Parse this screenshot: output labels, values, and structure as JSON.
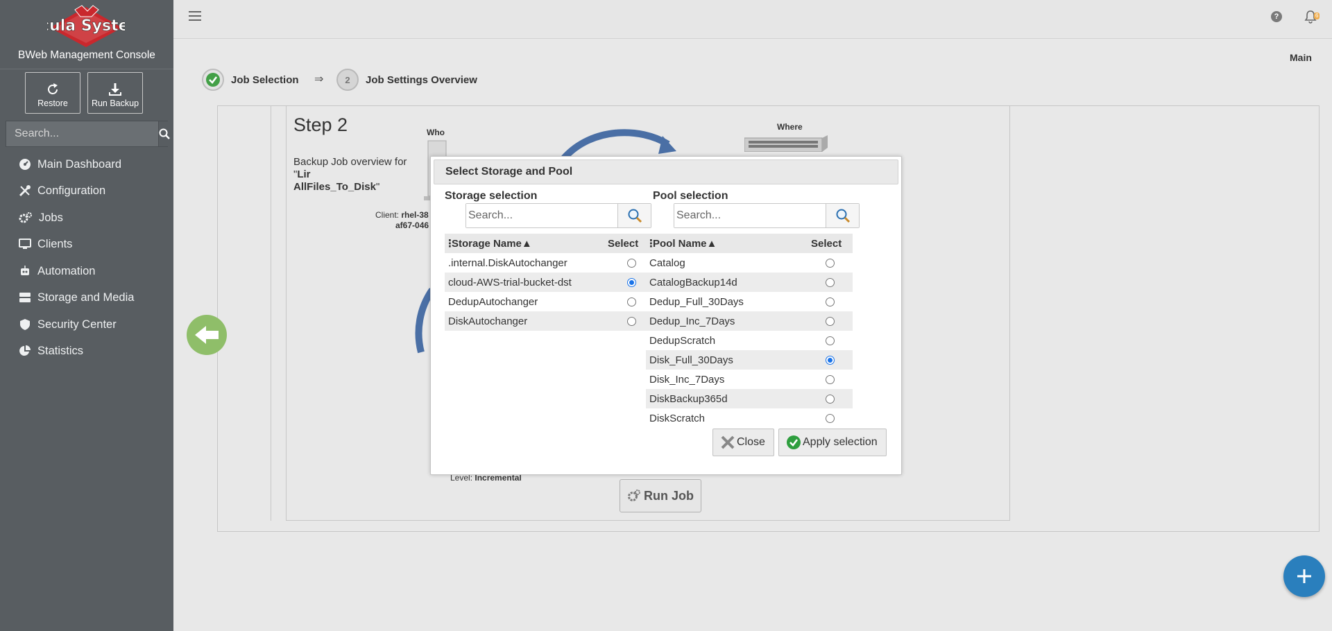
{
  "sidebar": {
    "console_title": "BWeb Management Console",
    "logo_text": "Bacula Systems",
    "restore_label": "Restore",
    "run_backup_label": "Run Backup",
    "search_placeholder": "Search...",
    "nav": [
      {
        "label": "Main Dashboard",
        "icon": "dashboard-icon"
      },
      {
        "label": "Configuration",
        "icon": "tools-icon"
      },
      {
        "label": "Jobs",
        "icon": "gears-icon"
      },
      {
        "label": "Clients",
        "icon": "monitor-icon"
      },
      {
        "label": "Automation",
        "icon": "robot-icon"
      },
      {
        "label": "Storage and Media",
        "icon": "storage-icon"
      },
      {
        "label": "Security Center",
        "icon": "shield-icon"
      },
      {
        "label": "Statistics",
        "icon": "pie-chart-icon"
      }
    ]
  },
  "topbar": {
    "help": "?",
    "notification_count": "6"
  },
  "main": {
    "label": "Main",
    "steps": [
      {
        "label": "Job Selection"
      },
      {
        "number": "2",
        "label": "Job Settings Overview"
      }
    ],
    "step_arrow": "⇒",
    "step_panel": {
      "title": "Step 2",
      "desc_prefix": "Backup Job overview for \"",
      "desc_bold1": "Lir",
      "desc_bold2": "AllFiles_To_Disk",
      "desc_suffix": "\"",
      "who": "Who",
      "where": "Where",
      "client_prefix": "Client: ",
      "client_name": "rhel-38",
      "client_id": "af67-046",
      "level_prefix": "Level: ",
      "level_value": "Incremental",
      "run_job_label": "Run Job"
    }
  },
  "dialog": {
    "title": "Select Storage and Pool",
    "storage": {
      "title": "Storage selection",
      "search_placeholder": "Search...",
      "col_name": "Storage Name",
      "col_select": "Select",
      "rows": [
        {
          "name": ".internal.DiskAutochanger",
          "selected": false
        },
        {
          "name": "cloud-AWS-trial-bucket-dst",
          "selected": true
        },
        {
          "name": "DedupAutochanger",
          "selected": false
        },
        {
          "name": "DiskAutochanger",
          "selected": false
        }
      ]
    },
    "pool": {
      "title": "Pool selection",
      "search_placeholder": "Search...",
      "col_name": "Pool Name",
      "col_select": "Select",
      "rows": [
        {
          "name": "Catalog",
          "selected": false
        },
        {
          "name": "CatalogBackup14d",
          "selected": false
        },
        {
          "name": "Dedup_Full_30Days",
          "selected": false
        },
        {
          "name": "Dedup_Inc_7Days",
          "selected": false
        },
        {
          "name": "DedupScratch",
          "selected": false
        },
        {
          "name": "Disk_Full_30Days",
          "selected": true
        },
        {
          "name": "Disk_Inc_7Days",
          "selected": false
        },
        {
          "name": "DiskBackup365d",
          "selected": false
        },
        {
          "name": "DiskScratch",
          "selected": false
        }
      ]
    },
    "close_label": "Close",
    "apply_label": "Apply selection"
  },
  "colors": {
    "sidebar_bg": "#585d61",
    "accent_blue": "#2a7fbd",
    "success_green": "#8fbe69"
  }
}
